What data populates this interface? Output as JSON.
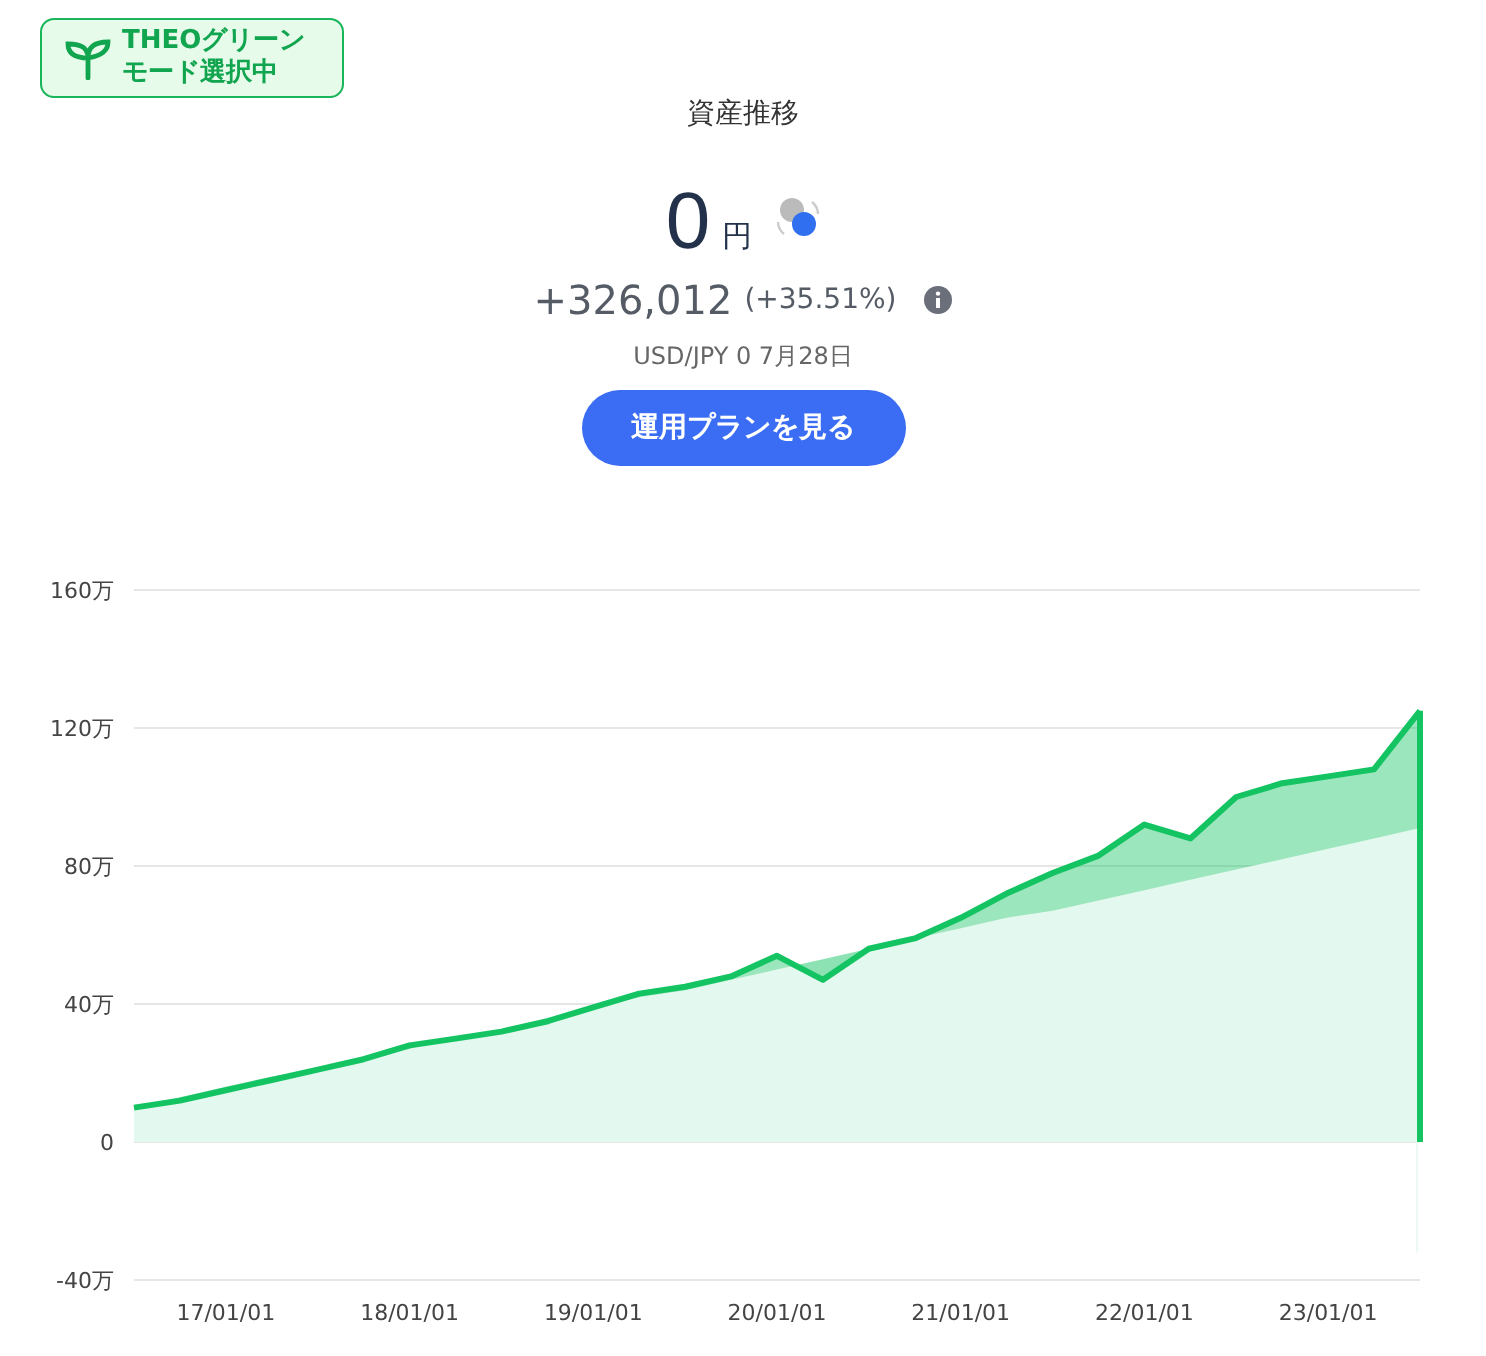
{
  "badge": {
    "line1": "THEOグリーン",
    "line2": "モード選択中"
  },
  "title": "資産推移",
  "balance": {
    "amount": "0",
    "unit": "円"
  },
  "gain": {
    "value": "+326,012",
    "percent": "(+35.51%)"
  },
  "rate_note": "USD/JPY 0 7月28日",
  "plan_button": "運用プランを見る",
  "chart_data": {
    "type": "area",
    "categories": [
      null,
      null,
      "17/01/01",
      null,
      null,
      null,
      "18/01/01",
      null,
      null,
      null,
      "19/01/01",
      null,
      null,
      null,
      "20/01/01",
      null,
      null,
      null,
      "21/01/01",
      null,
      null,
      null,
      "22/01/01",
      null,
      null,
      null,
      "23/01/01",
      null,
      null
    ],
    "series": [
      {
        "color": "#14c462",
        "values": [
          10,
          12,
          15,
          18,
          21,
          24,
          28,
          30,
          32,
          35,
          39,
          43,
          45,
          48,
          54,
          47,
          56,
          59,
          65,
          72,
          78,
          83,
          92,
          88,
          100,
          104,
          106,
          108,
          125
        ]
      },
      {
        "color": "#e3f8ee",
        "values": [
          10,
          13,
          16,
          19,
          21,
          24,
          27,
          30,
          32,
          34,
          39,
          42,
          44,
          47,
          50,
          53,
          56,
          59,
          62,
          65,
          67,
          70,
          73,
          76,
          79,
          82,
          85,
          88,
          91
        ]
      }
    ],
    "ylim": [
      -40,
      160
    ],
    "grid": true,
    "yticks": [
      {
        "value": 160,
        "label": "160万"
      },
      {
        "value": 120,
        "label": "120万"
      },
      {
        "value": 80,
        "label": "80万"
      },
      {
        "value": 40,
        "label": "40万"
      },
      {
        "value": 0,
        "label": "0"
      },
      {
        "value": -40,
        "label": "-40万"
      }
    ]
  }
}
